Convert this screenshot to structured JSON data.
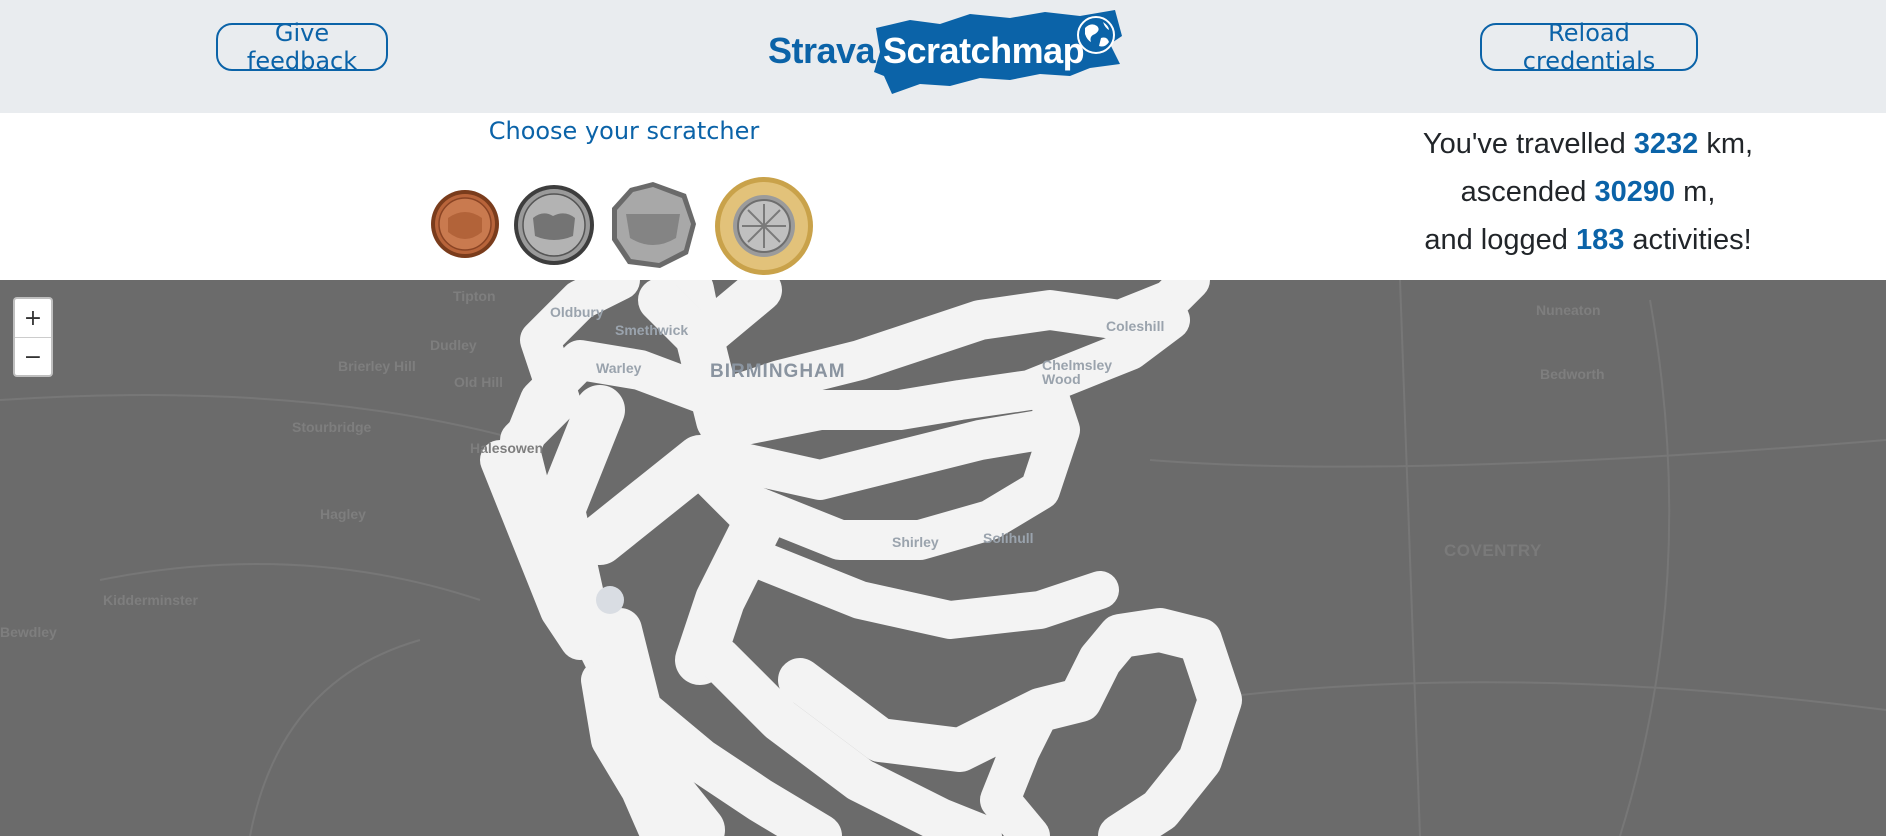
{
  "header": {
    "feedback_label": "Give feedback",
    "reload_label": "Reload credentials",
    "logo": {
      "part1": "Strava",
      "part2": "Scratchmap",
      "brand_color": "#0b63a8"
    }
  },
  "scratcher": {
    "label": "Choose your scratcher",
    "coins": [
      "one penny",
      "ten pence",
      "fifty pence",
      "two pounds"
    ]
  },
  "stats": {
    "line1_prefix": "You've travelled",
    "distance": "3232",
    "line1_suffix": "km,",
    "line2_prefix": "ascended",
    "elevation": "30290",
    "line2_suffix": "m,",
    "line3_prefix": "and logged",
    "activities": "183",
    "line3_suffix": "activities!"
  },
  "map": {
    "zoom_in": "+",
    "zoom_out": "−",
    "labels": {
      "tipton": "Tipton",
      "dudley": "Dudley",
      "oldbury": "Oldbury",
      "smethwick": "Smethwick",
      "brierley_hill": "Brierley Hill",
      "old_hill": "Old Hill",
      "warley": "Warley",
      "birmingham": "BIRMINGHAM",
      "coleshill": "Coleshill",
      "chelmsley_wood": "Chelmsley Wood",
      "stourbridge": "Stourbridge",
      "halesowen": "Halesowen",
      "hagley": "Hagley",
      "shirley": "Shirley",
      "solihull": "Solihull",
      "kidderminster": "Kidderminster",
      "bewdley": "Bewdley",
      "nuneaton": "Nuneaton",
      "bedworth": "Bedworth",
      "coventry": "COVENTRY"
    }
  }
}
